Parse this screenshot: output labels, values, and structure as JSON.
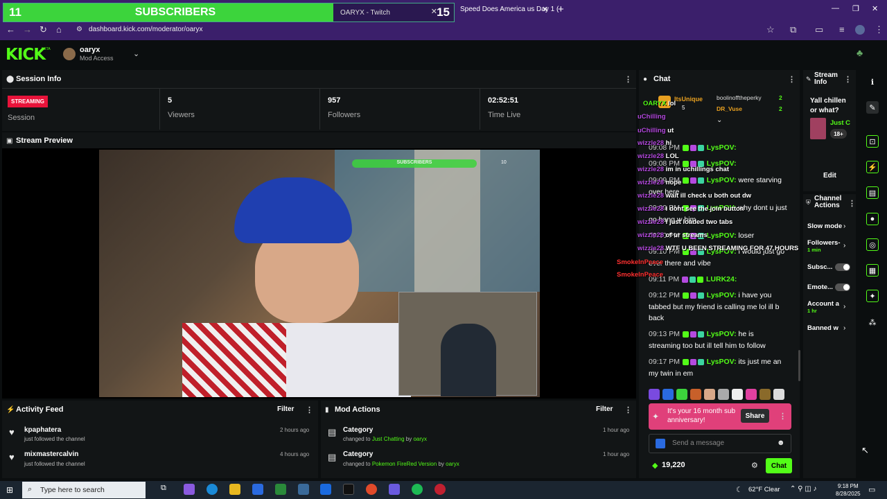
{
  "browser": {
    "sub_goal_current": "11",
    "sub_goal_label": "SUBSCRIBERS",
    "sub_goal_target": "15",
    "tab1_title": "OARYX - Twitch",
    "tab2_title": "Speed Does America us Day 1 (",
    "url": "dashboard.kick.com/moderator/oaryx"
  },
  "kick": {
    "logo": "KICK",
    "beta": "BETA",
    "user": "oaryx",
    "access": "Mod Access"
  },
  "session": {
    "title": "Session Info",
    "badge": "STREAMING",
    "badge_label": "Session",
    "viewers": "5",
    "viewers_label": "Viewers",
    "followers": "957",
    "followers_label": "Followers",
    "time_live": "02:52:51",
    "time_label": "Time Live"
  },
  "preview": {
    "title": "Stream Preview",
    "overlay_goal": "SUBSCRIBERS",
    "overlay_goal_num": "10"
  },
  "activity": {
    "title": "Activity Feed",
    "filter": "Filter",
    "rows": [
      {
        "name": "kpaphatera",
        "desc": "just followed the channel",
        "time": "2 hours ago"
      },
      {
        "name": "mixmastercalvin",
        "desc": "just followed the channel",
        "time": "4 hours ago"
      }
    ]
  },
  "modactions": {
    "title": "Mod Actions",
    "filter": "Filter",
    "rows": [
      {
        "title": "Category",
        "pre": "changed to",
        "val": "Just Chatting",
        "by": "by",
        "who": "oaryx",
        "time": "1 hour ago"
      },
      {
        "title": "Category",
        "pre": "changed to",
        "val": "Pokemon FireRed Version",
        "by": "by",
        "who": "oaryx",
        "time": "1 hour ago"
      }
    ]
  },
  "chat": {
    "title": "Chat",
    "pinned": {
      "a_name": "ItsUnique",
      "a_num": "5",
      "b_name": "boolinofftheperky",
      "b_num": "2",
      "c_name": "DR_Vuse",
      "c_num": "2"
    },
    "messages": [
      {
        "time": "09:08 PM",
        "user": "LysPOV:",
        "text": ""
      },
      {
        "time": "09:08 PM",
        "user": "LysPOV:",
        "text": ""
      },
      {
        "time": "09:09 PM",
        "user": "LysPOV:",
        "text": "were starving over here"
      },
      {
        "time": "09:09 PM",
        "user": "LysPOV:",
        "text": "why dont u just go hang w him"
      },
      {
        "time": "09:10 PM",
        "user": "LysPOV:",
        "text": "loser"
      },
      {
        "time": "09:10 PM",
        "user": "LysPOV:",
        "text": "i would just go over there and vibe"
      },
      {
        "time": "09:11 PM",
        "user": "LURK24:",
        "text": ""
      },
      {
        "time": "09:12 PM",
        "user": "LysPOV:",
        "text": "i have you tabbed but my friend is calling me lol ill b back"
      },
      {
        "time": "09:13 PM",
        "user": "LysPOV:",
        "text": "he is streaming too but ill tell him to follow"
      },
      {
        "time": "09:17 PM",
        "user": "LysPOV:",
        "text": "its just me an my twin in em"
      }
    ],
    "overlay": [
      {
        "user": "OARYX",
        "text": "lol"
      },
      {
        "user": "uChilling",
        "text": ""
      },
      {
        "user": "uChilling",
        "text": "ut"
      },
      {
        "user": "wizzle28",
        "text": "hi"
      },
      {
        "user": "wizzle28",
        "text": "LOL"
      },
      {
        "user": "wizzle28",
        "text": "im in uchillings chat"
      },
      {
        "user": "wizzle28",
        "text": "nope"
      },
      {
        "user": "wizzle28",
        "text": "wait ill check u both out dw"
      },
      {
        "user": "wizzle28",
        "text": "i dont see the join button"
      },
      {
        "user": "wizzle28",
        "text": "i just loaded two tabs"
      },
      {
        "user": "wizzle28",
        "text": "of ur streams"
      },
      {
        "user": "wizzle28",
        "text": "WTF U BEEN STREAMING FOR 47 HOURS"
      },
      {
        "user": "SmokeInPeace",
        "text": ""
      },
      {
        "user": "SmokeInPeace",
        "text": ""
      }
    ],
    "anniversary": "It's your 16 month sub anniversary!",
    "share": "Share",
    "placeholder": "Send a message",
    "points": "19,220",
    "chat_button": "Chat"
  },
  "stream_info": {
    "title": "Stream Info",
    "stream_title": "Yall chillen or what?",
    "category": "Just C",
    "rating": "18+",
    "edit": "Edit"
  },
  "channel_actions": {
    "title": "Channel Actions",
    "items": [
      {
        "label": "Slow mode",
        "sub": ""
      },
      {
        "label": "Followers-",
        "sub": "1 min"
      },
      {
        "label": "Subsc...",
        "sub": ""
      },
      {
        "label": "Emote...",
        "sub": ""
      },
      {
        "label": "Account a",
        "sub": "1 hr"
      },
      {
        "label": "Banned w",
        "sub": ""
      }
    ]
  },
  "taskbar": {
    "search": "Type here to search",
    "weather": "62°F  Clear",
    "time": "9:18 PM",
    "date": "8/28/2025"
  },
  "colors": {
    "kick_green": "#53fc18",
    "streaming_red": "#e8133a",
    "anniversary_pink": "#e0407a",
    "tabbar_purple": "#3b1f6b"
  }
}
